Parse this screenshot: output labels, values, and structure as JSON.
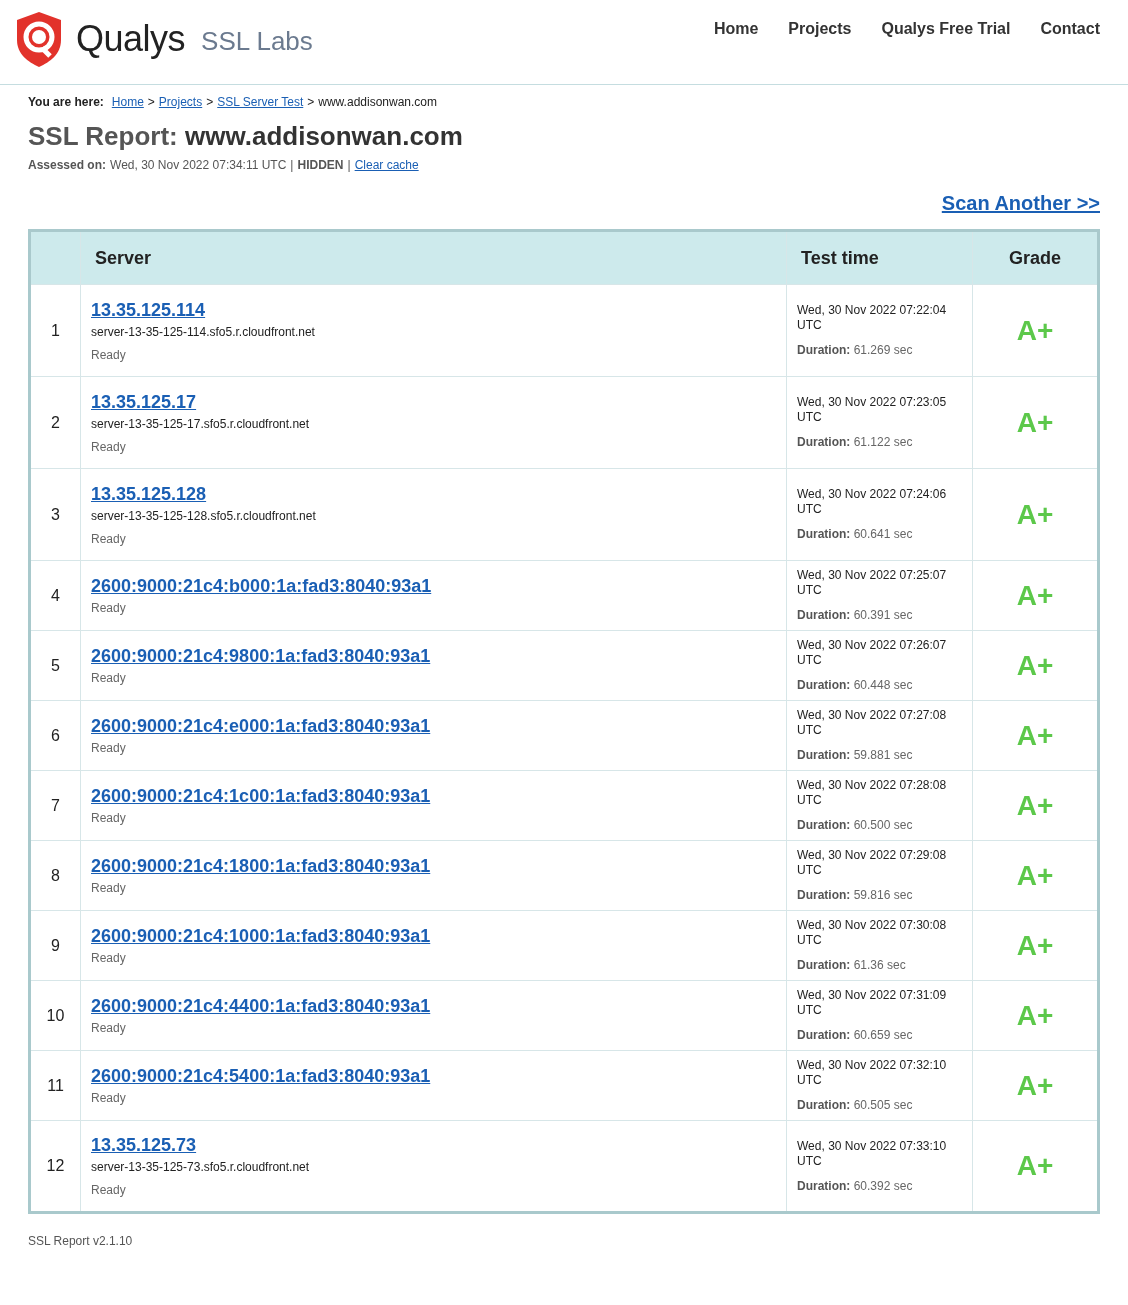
{
  "header": {
    "brand": "Qualys",
    "product": "SSL Labs",
    "nav": [
      "Home",
      "Projects",
      "Qualys Free Trial",
      "Contact"
    ]
  },
  "breadcrumb": {
    "label": "You are here:",
    "separator": ">",
    "links": [
      "Home",
      "Projects",
      "SSL Server Test"
    ],
    "current": "www.addisonwan.com"
  },
  "report": {
    "title_prefix": "SSL Report:",
    "title_host": "www.addisonwan.com",
    "assessed_label": "Assessed on:",
    "assessed_date": "Wed, 30 Nov 2022 07:34:11 UTC",
    "separator": "|",
    "status": "HIDDEN",
    "clear_cache": "Clear cache"
  },
  "scan_another": "Scan Another >>",
  "table": {
    "columns": [
      "Server",
      "Test time",
      "Grade"
    ],
    "rows": [
      {
        "number": "1",
        "address": "13.35.125.114",
        "hostname": "server-13-35-125-114.sfo5.r.cloudfront.net",
        "status": "Ready",
        "test_time": "Wed, 30 Nov 2022 07:22:04 UTC",
        "duration_label": "Duration:",
        "duration": "61.269 sec",
        "grade": "A+"
      },
      {
        "number": "2",
        "address": "13.35.125.17",
        "hostname": "server-13-35-125-17.sfo5.r.cloudfront.net",
        "status": "Ready",
        "test_time": "Wed, 30 Nov 2022 07:23:05 UTC",
        "duration_label": "Duration:",
        "duration": "61.122 sec",
        "grade": "A+"
      },
      {
        "number": "3",
        "address": "13.35.125.128",
        "hostname": "server-13-35-125-128.sfo5.r.cloudfront.net",
        "status": "Ready",
        "test_time": "Wed, 30 Nov 2022 07:24:06 UTC",
        "duration_label": "Duration:",
        "duration": "60.641 sec",
        "grade": "A+"
      },
      {
        "number": "4",
        "address": "2600:9000:21c4:b000:1a:fad3:8040:93a1",
        "status": "Ready",
        "test_time": "Wed, 30 Nov 2022 07:25:07 UTC",
        "duration_label": "Duration:",
        "duration": "60.391 sec",
        "grade": "A+"
      },
      {
        "number": "5",
        "address": "2600:9000:21c4:9800:1a:fad3:8040:93a1",
        "status": "Ready",
        "test_time": "Wed, 30 Nov 2022 07:26:07 UTC",
        "duration_label": "Duration:",
        "duration": "60.448 sec",
        "grade": "A+"
      },
      {
        "number": "6",
        "address": "2600:9000:21c4:e000:1a:fad3:8040:93a1",
        "status": "Ready",
        "test_time": "Wed, 30 Nov 2022 07:27:08 UTC",
        "duration_label": "Duration:",
        "duration": "59.881 sec",
        "grade": "A+"
      },
      {
        "number": "7",
        "address": "2600:9000:21c4:1c00:1a:fad3:8040:93a1",
        "status": "Ready",
        "test_time": "Wed, 30 Nov 2022 07:28:08 UTC",
        "duration_label": "Duration:",
        "duration": "60.500 sec",
        "grade": "A+"
      },
      {
        "number": "8",
        "address": "2600:9000:21c4:1800:1a:fad3:8040:93a1",
        "status": "Ready",
        "test_time": "Wed, 30 Nov 2022 07:29:08 UTC",
        "duration_label": "Duration:",
        "duration": "59.816 sec",
        "grade": "A+"
      },
      {
        "number": "9",
        "address": "2600:9000:21c4:1000:1a:fad3:8040:93a1",
        "status": "Ready",
        "test_time": "Wed, 30 Nov 2022 07:30:08 UTC",
        "duration_label": "Duration:",
        "duration": "61.36 sec",
        "grade": "A+"
      },
      {
        "number": "10",
        "address": "2600:9000:21c4:4400:1a:fad3:8040:93a1",
        "status": "Ready",
        "test_time": "Wed, 30 Nov 2022 07:31:09 UTC",
        "duration_label": "Duration:",
        "duration": "60.659 sec",
        "grade": "A+"
      },
      {
        "number": "11",
        "address": "2600:9000:21c4:5400:1a:fad3:8040:93a1",
        "status": "Ready",
        "test_time": "Wed, 30 Nov 2022 07:32:10 UTC",
        "duration_label": "Duration:",
        "duration": "60.505 sec",
        "grade": "A+"
      },
      {
        "number": "12",
        "address": "13.35.125.73",
        "hostname": "server-13-35-125-73.sfo5.r.cloudfront.net",
        "status": "Ready",
        "test_time": "Wed, 30 Nov 2022 07:33:10 UTC",
        "duration_label": "Duration:",
        "duration": "60.392 sec",
        "grade": "A+"
      }
    ]
  },
  "footer": "SSL Report v2.1.10"
}
